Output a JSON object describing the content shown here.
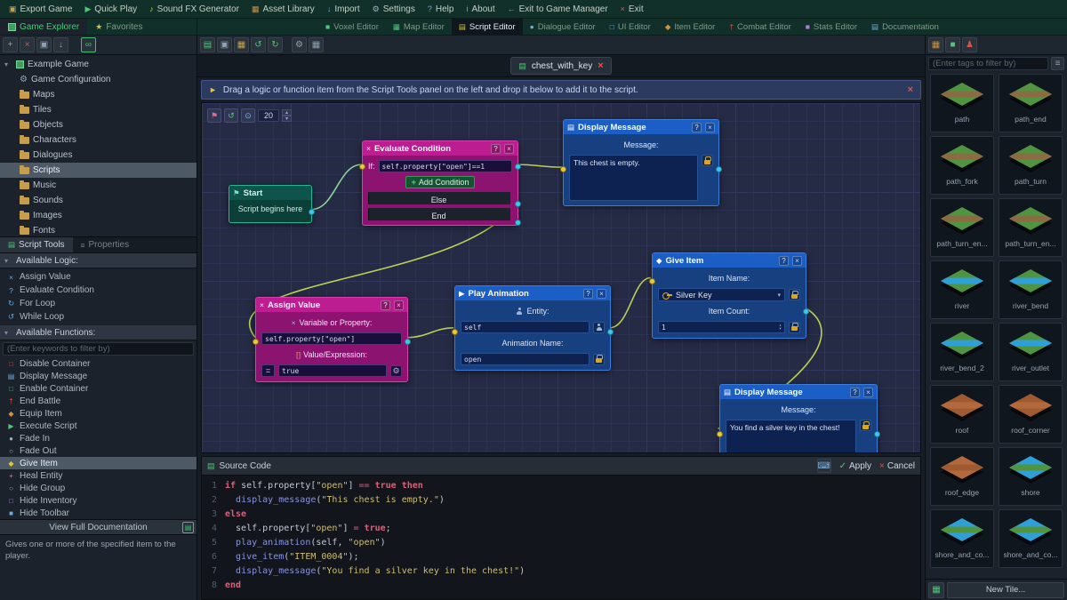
{
  "colors": {
    "accent_green": "#46b96e",
    "node_logic_header": "#bc1e92",
    "node_function_header": "#1b5fc6",
    "node_event_header": "#0e544a",
    "port_in": "#e9c837",
    "port_out": "#41c4e8",
    "wire": "#bdd054",
    "apply_green": "#4cc878",
    "cancel_red": "#e05548"
  },
  "menubar": {
    "items": [
      {
        "label": "Export Game",
        "icon": "export-icon",
        "glyph": "▣",
        "color": "#c9a14e"
      },
      {
        "label": "Quick Play",
        "icon": "play-icon",
        "glyph": "▶",
        "color": "#4cc878"
      },
      {
        "label": "Sound FX Generator",
        "icon": "sound-icon",
        "glyph": "♪",
        "color": "#d8c53e"
      },
      {
        "label": "Asset Library",
        "icon": "asset-library-icon",
        "glyph": "▦",
        "color": "#d0913d"
      },
      {
        "label": "Import",
        "icon": "import-icon",
        "glyph": "↓",
        "color": "#6fa8dc"
      },
      {
        "label": "Settings",
        "icon": "gear-icon",
        "glyph": "⚙",
        "color": "#9fb0bd"
      },
      {
        "label": "Help",
        "icon": "help-icon",
        "glyph": "?",
        "color": "#6fa8dc"
      },
      {
        "label": "About",
        "icon": "about-icon",
        "glyph": "i",
        "color": "#6fa8dc"
      },
      {
        "label": "Exit to Game Manager",
        "icon": "exit-manager-icon",
        "glyph": "←",
        "color": "#d0913d"
      },
      {
        "label": "Exit",
        "icon": "exit-icon",
        "glyph": "×",
        "color": "#e05548"
      }
    ]
  },
  "explorer_tabs": {
    "game_explorer": "Game Explorer",
    "favorites": "Favorites"
  },
  "editor_tabs": [
    {
      "label": "Voxel Editor",
      "icon": "voxel-editor-icon",
      "glyph": "■",
      "color": "#4cc878",
      "active": false
    },
    {
      "label": "Map Editor",
      "icon": "map-editor-icon",
      "glyph": "▦",
      "color": "#4cc878",
      "active": false
    },
    {
      "label": "Script Editor",
      "icon": "script-editor-icon",
      "glyph": "▤",
      "color": "#d8c53e",
      "active": true
    },
    {
      "label": "Dialogue Editor",
      "icon": "dialogue-editor-icon",
      "glyph": "●",
      "color": "#6fa8dc",
      "active": false
    },
    {
      "label": "UI Editor",
      "icon": "ui-editor-icon",
      "glyph": "□",
      "color": "#6fa8dc",
      "active": false
    },
    {
      "label": "Item Editor",
      "icon": "item-editor-icon",
      "glyph": "◆",
      "color": "#d0913d",
      "active": false
    },
    {
      "label": "Combat Editor",
      "icon": "combat-editor-icon",
      "glyph": "†",
      "color": "#e05548",
      "active": false
    },
    {
      "label": "Stats Editor",
      "icon": "stats-editor-icon",
      "glyph": "■",
      "color": "#b07fd8",
      "active": false
    },
    {
      "label": "Documentation",
      "icon": "documentation-icon",
      "glyph": "▤",
      "color": "#6fa8dc",
      "active": false
    }
  ],
  "tree": {
    "root": {
      "label": "Example Game",
      "icon": "cube-icon"
    },
    "items": [
      {
        "label": "Game Configuration",
        "icon": "gear-icon",
        "selected": false
      },
      {
        "label": "Maps",
        "icon": "folder-icon",
        "selected": false
      },
      {
        "label": "Tiles",
        "icon": "folder-icon",
        "selected": false
      },
      {
        "label": "Objects",
        "icon": "folder-icon",
        "selected": false
      },
      {
        "label": "Characters",
        "icon": "folder-icon",
        "selected": false
      },
      {
        "label": "Dialogues",
        "icon": "folder-icon",
        "selected": false
      },
      {
        "label": "Scripts",
        "icon": "folder-icon",
        "selected": true
      },
      {
        "label": "Music",
        "icon": "folder-icon",
        "selected": false
      },
      {
        "label": "Sounds",
        "icon": "folder-icon",
        "selected": false
      },
      {
        "label": "Images",
        "icon": "folder-icon",
        "selected": false
      },
      {
        "label": "Fonts",
        "icon": "folder-icon",
        "selected": false
      }
    ]
  },
  "script_tools": {
    "tab_script_tools": "Script Tools",
    "tab_properties": "Properties",
    "logic_header": "Available Logic:",
    "logic_items": [
      {
        "label": "Assign Value",
        "glyph": "×",
        "color": "#6fa8dc"
      },
      {
        "label": "Evaluate Condition",
        "glyph": "?",
        "color": "#6fa8dc"
      },
      {
        "label": "For Loop",
        "glyph": "↻",
        "color": "#6fa8dc"
      },
      {
        "label": "While Loop",
        "glyph": "↺",
        "color": "#6fa8dc"
      }
    ],
    "functions_header": "Available Functions:",
    "filter_placeholder": "(Enter keywords to filter by)",
    "function_items": [
      {
        "label": "Disable Container",
        "glyph": "□",
        "color": "#e05548",
        "selected": false
      },
      {
        "label": "Display Message",
        "glyph": "▤",
        "color": "#6fa8dc",
        "selected": false
      },
      {
        "label": "Enable Container",
        "glyph": "□",
        "color": "#4cc878",
        "selected": false
      },
      {
        "label": "End Battle",
        "glyph": "†",
        "color": "#e05548",
        "selected": false
      },
      {
        "label": "Equip Item",
        "glyph": "◆",
        "color": "#d0913d",
        "selected": false
      },
      {
        "label": "Execute Script",
        "glyph": "▶",
        "color": "#4cc878",
        "selected": false
      },
      {
        "label": "Fade In",
        "glyph": "●",
        "color": "#9fb0bd",
        "selected": false
      },
      {
        "label": "Fade Out",
        "glyph": "○",
        "color": "#9fb0bd",
        "selected": false
      },
      {
        "label": "Give Item",
        "glyph": "◆",
        "color": "#d8c53e",
        "selected": true
      },
      {
        "label": "Heal Entity",
        "glyph": "+",
        "color": "#e07f9a",
        "selected": false
      },
      {
        "label": "Hide Group",
        "glyph": "○",
        "color": "#6fa8dc",
        "selected": false
      },
      {
        "label": "Hide Inventory",
        "glyph": "□",
        "color": "#b07fd8",
        "selected": false
      },
      {
        "label": "Hide Toolbar",
        "glyph": "■",
        "color": "#6fa8dc",
        "selected": false
      }
    ],
    "doc_button": "View Full Documentation",
    "description": "Gives one or more of the specified item to the player."
  },
  "script_editor": {
    "tab": "chest_with_key",
    "hint": "Drag a logic or function item from the Script Tools panel on the left and drop it below to add it to the script.",
    "zoom": "20"
  },
  "nodes": {
    "start": {
      "title": "Start",
      "body": "Script begins here"
    },
    "evaluate": {
      "title": "Evaluate Condition",
      "if_label": "If:",
      "if_value": "self.property[\"open\"]==1",
      "add_condition": "Add Condition",
      "else_label": "Else",
      "end_label": "End"
    },
    "display1": {
      "title": "Display Message",
      "message_label": "Message:",
      "message": "This chest is empty."
    },
    "assign": {
      "title": "Assign Value",
      "var_label": "Variable or Property:",
      "var_value": "self.property[\"open\"]",
      "val_label": "Value/Expression:",
      "op": "=",
      "value": "true"
    },
    "play": {
      "title": "Play Animation",
      "entity_label": "Entity:",
      "entity": "self",
      "anim_label": "Animation Name:",
      "anim": "open"
    },
    "give": {
      "title": "Give Item",
      "item_label": "Item Name:",
      "item": "Silver Key",
      "count_label": "Item Count:",
      "count": "1"
    },
    "display2": {
      "title": "Display Message",
      "message_label": "Message:",
      "message": "You find a silver key in the chest!"
    }
  },
  "source": {
    "title": "Source Code",
    "apply": "Apply",
    "cancel": "Cancel",
    "lines": [
      [
        {
          "c": "kw",
          "t": "if"
        },
        {
          "c": "pl",
          "t": " self.property["
        },
        {
          "c": "st",
          "t": "\"open\""
        },
        {
          "c": "pl",
          "t": "] "
        },
        {
          "c": "op",
          "t": "=="
        },
        {
          "c": "pl",
          "t": " "
        },
        {
          "c": "kw",
          "t": "true"
        },
        {
          "c": "pl",
          "t": " "
        },
        {
          "c": "kw",
          "t": "then"
        }
      ],
      [
        {
          "c": "pl",
          "t": "  "
        },
        {
          "c": "fn",
          "t": "display_message"
        },
        {
          "c": "pl",
          "t": "("
        },
        {
          "c": "st",
          "t": "\"This chest is empty.\""
        },
        {
          "c": "pl",
          "t": ")"
        }
      ],
      [
        {
          "c": "kw",
          "t": "else"
        }
      ],
      [
        {
          "c": "pl",
          "t": "  self.property["
        },
        {
          "c": "st",
          "t": "\"open\""
        },
        {
          "c": "pl",
          "t": "] "
        },
        {
          "c": "op",
          "t": "="
        },
        {
          "c": "pl",
          "t": " "
        },
        {
          "c": "kw",
          "t": "true"
        },
        {
          "c": "pl",
          "t": ";"
        }
      ],
      [
        {
          "c": "pl",
          "t": "  "
        },
        {
          "c": "fn",
          "t": "play_animation"
        },
        {
          "c": "pl",
          "t": "(self, "
        },
        {
          "c": "st",
          "t": "\"open\""
        },
        {
          "c": "pl",
          "t": ")"
        }
      ],
      [
        {
          "c": "pl",
          "t": "  "
        },
        {
          "c": "fn",
          "t": "give_item"
        },
        {
          "c": "pl",
          "t": "("
        },
        {
          "c": "st",
          "t": "\"ITEM_0004\""
        },
        {
          "c": "pl",
          "t": ");"
        }
      ],
      [
        {
          "c": "pl",
          "t": "  "
        },
        {
          "c": "fn",
          "t": "display_message"
        },
        {
          "c": "pl",
          "t": "("
        },
        {
          "c": "st",
          "t": "\"You find a silver key in the chest!\""
        },
        {
          "c": "pl",
          "t": ")"
        }
      ],
      [
        {
          "c": "kw",
          "t": "end"
        }
      ]
    ]
  },
  "right_panel": {
    "filter_placeholder": "(Enter tags to filter by)",
    "new_tile": "New Tile...",
    "tiles": [
      {
        "name": "path",
        "c1": "#4f9440",
        "c2": "#8a6b42"
      },
      {
        "name": "path_end",
        "c1": "#4f9440",
        "c2": "#8a6b42"
      },
      {
        "name": "path_fork",
        "c1": "#4f9440",
        "c2": "#8a6b42"
      },
      {
        "name": "path_turn",
        "c1": "#4f9440",
        "c2": "#8a6b42"
      },
      {
        "name": "path_turn_en...",
        "c1": "#4f9440",
        "c2": "#8a6b42"
      },
      {
        "name": "path_turn_en...",
        "c1": "#4f9440",
        "c2": "#8a6b42"
      },
      {
        "name": "river",
        "c1": "#4f9440",
        "c2": "#2f9fd8"
      },
      {
        "name": "river_bend",
        "c1": "#4f9440",
        "c2": "#2f9fd8"
      },
      {
        "name": "river_bend_2",
        "c1": "#4f9440",
        "c2": "#2f9fd8"
      },
      {
        "name": "river_outlet",
        "c1": "#4f9440",
        "c2": "#2f9fd8"
      },
      {
        "name": "roof",
        "c1": "#a05a32",
        "c2": "#b4693c"
      },
      {
        "name": "roof_corner",
        "c1": "#a05a32",
        "c2": "#b4693c"
      },
      {
        "name": "roof_edge",
        "c1": "#b4693c",
        "c2": "#a05a32"
      },
      {
        "name": "shore",
        "c1": "#2f9fd8",
        "c2": "#4f9440"
      },
      {
        "name": "shore_and_co...",
        "c1": "#2f9fd8",
        "c2": "#4f9440"
      },
      {
        "name": "shore_and_co...",
        "c1": "#2f9fd8",
        "c2": "#4f9440"
      }
    ]
  }
}
